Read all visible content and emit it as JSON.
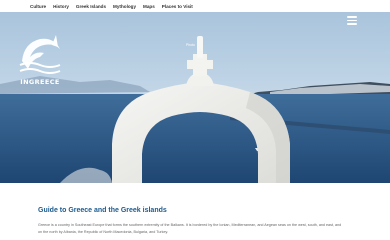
{
  "nav": {
    "items": [
      {
        "label": "Culture"
      },
      {
        "label": "History"
      },
      {
        "label": "Greek Islands"
      },
      {
        "label": "Mythology"
      },
      {
        "label": "Maps"
      },
      {
        "label": "Places to Visit"
      }
    ]
  },
  "hero": {
    "logo_text": "INGREECE",
    "small_label": "Photo"
  },
  "content": {
    "heading": "Guide to Greece and the Greek islands",
    "paragraph": "Greece is a country in Southeast Europe that forms the southern extremity of the Balkans. It is bordered by the Ionian, Mediterranean, and Aegean seas on the west, south, and east, and on the north by Albania, the Republic of North Macedonia, Bulgaria, and Turkey."
  },
  "colors": {
    "heading": "#1c5a8c",
    "sea": "#2f5a8a",
    "sky": "#b8d1e6"
  }
}
